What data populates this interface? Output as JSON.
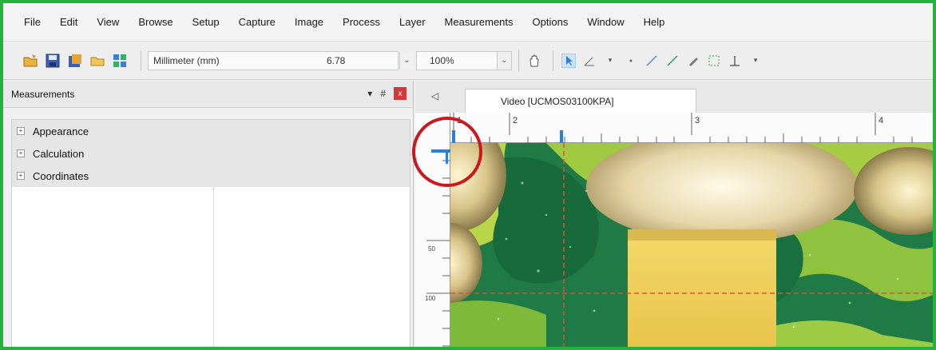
{
  "menu": [
    "File",
    "Edit",
    "View",
    "Browse",
    "Setup",
    "Capture",
    "Image",
    "Process",
    "Layer",
    "Measurements",
    "Options",
    "Window",
    "Help"
  ],
  "toolbar": {
    "unit_select": "Millimeter (mm)",
    "scale_value": "6.78",
    "zoom_value": "100%",
    "icons": [
      "open-folder-icon",
      "save-icon",
      "save-all-icon",
      "browse-folder-icon",
      "layout-icon",
      "pan-hand-icon",
      "pointer-icon",
      "angle-icon",
      "point-icon",
      "line-icon",
      "polyline-icon",
      "pen-icon",
      "region-icon",
      "perpendicular-icon"
    ]
  },
  "panel": {
    "title": "Measurements",
    "pin_label": "▾",
    "float_label": "#",
    "close_label": "x",
    "sections": [
      "Appearance",
      "Calculation",
      "Coordinates"
    ]
  },
  "document": {
    "tab_title": "Video [UCMOS03100KPA]",
    "tab_nav": "◁",
    "h_ruler_labels": [
      "1",
      "2",
      "3",
      "4"
    ],
    "v_ruler_labels": [
      "50",
      "100"
    ]
  },
  "colors": {
    "frame_border": "#22b33a",
    "highlight_circle": "#d42020",
    "crosshair": "#e0503a",
    "ruler_marker": "#2a7fd8"
  }
}
